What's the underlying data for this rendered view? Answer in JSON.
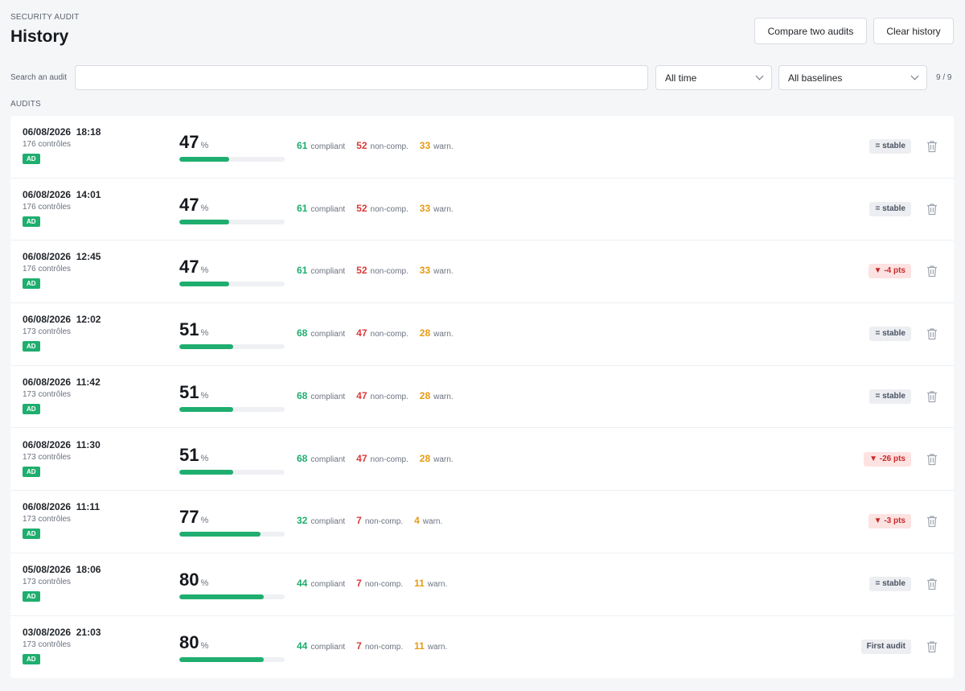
{
  "header": {
    "eyebrow": "SECURITY AUDIT",
    "title": "History",
    "compare_label": "Compare two audits",
    "clear_label": "Clear history"
  },
  "filters": {
    "search_label": "Search an audit",
    "search_value": "",
    "time_value": "All time",
    "baseline_value": "All baselines",
    "count": "9 / 9"
  },
  "section_label": "AUDITS",
  "colors": {
    "green": "#1fae6f",
    "red": "#d93a3a",
    "orange": "#e69a12"
  },
  "icons": {
    "trash": "trash-icon",
    "chevron": "chevron-down-icon"
  },
  "audits": [
    {
      "date": "06/08/2026  18:18",
      "controls": "176 contrôles",
      "tag": "AD",
      "score": "47",
      "pct": "%",
      "compliant": "61",
      "compliant_label": "compliant",
      "noncomp": "52",
      "noncomp_label": "non-comp.",
      "warn": "33",
      "warn_label": "warn.",
      "badge": "= stable",
      "badge_kind": "neutral"
    },
    {
      "date": "06/08/2026  14:01",
      "controls": "176 contrôles",
      "tag": "AD",
      "score": "47",
      "pct": "%",
      "compliant": "61",
      "compliant_label": "compliant",
      "noncomp": "52",
      "noncomp_label": "non-comp.",
      "warn": "33",
      "warn_label": "warn.",
      "badge": "= stable",
      "badge_kind": "neutral"
    },
    {
      "date": "06/08/2026  12:45",
      "controls": "176 contrôles",
      "tag": "AD",
      "score": "47",
      "pct": "%",
      "compliant": "61",
      "compliant_label": "compliant",
      "noncomp": "52",
      "noncomp_label": "non-comp.",
      "warn": "33",
      "warn_label": "warn.",
      "badge": "▼ -4 pts",
      "badge_kind": "down"
    },
    {
      "date": "06/08/2026  12:02",
      "controls": "173 contrôles",
      "tag": "AD",
      "score": "51",
      "pct": "%",
      "compliant": "68",
      "compliant_label": "compliant",
      "noncomp": "47",
      "noncomp_label": "non-comp.",
      "warn": "28",
      "warn_label": "warn.",
      "badge": "= stable",
      "badge_kind": "neutral"
    },
    {
      "date": "06/08/2026  11:42",
      "controls": "173 contrôles",
      "tag": "AD",
      "score": "51",
      "pct": "%",
      "compliant": "68",
      "compliant_label": "compliant",
      "noncomp": "47",
      "noncomp_label": "non-comp.",
      "warn": "28",
      "warn_label": "warn.",
      "badge": "= stable",
      "badge_kind": "neutral"
    },
    {
      "date": "06/08/2026  11:30",
      "controls": "173 contrôles",
      "tag": "AD",
      "score": "51",
      "pct": "%",
      "compliant": "68",
      "compliant_label": "compliant",
      "noncomp": "47",
      "noncomp_label": "non-comp.",
      "warn": "28",
      "warn_label": "warn.",
      "badge": "▼ -26 pts",
      "badge_kind": "down"
    },
    {
      "date": "06/08/2026  11:11",
      "controls": "173 contrôles",
      "tag": "AD",
      "score": "77",
      "pct": "%",
      "compliant": "32",
      "compliant_label": "compliant",
      "noncomp": "7",
      "noncomp_label": "non-comp.",
      "warn": "4",
      "warn_label": "warn.",
      "badge": "▼ -3 pts",
      "badge_kind": "down"
    },
    {
      "date": "05/08/2026  18:06",
      "controls": "173 contrôles",
      "tag": "AD",
      "score": "80",
      "pct": "%",
      "compliant": "44",
      "compliant_label": "compliant",
      "noncomp": "7",
      "noncomp_label": "non-comp.",
      "warn": "11",
      "warn_label": "warn.",
      "badge": "= stable",
      "badge_kind": "neutral"
    },
    {
      "date": "03/08/2026  21:03",
      "controls": "173 contrôles",
      "tag": "AD",
      "score": "80",
      "pct": "%",
      "compliant": "44",
      "compliant_label": "compliant",
      "noncomp": "7",
      "noncomp_label": "non-comp.",
      "warn": "11",
      "warn_label": "warn.",
      "badge": "First audit",
      "badge_kind": "neutral"
    }
  ]
}
